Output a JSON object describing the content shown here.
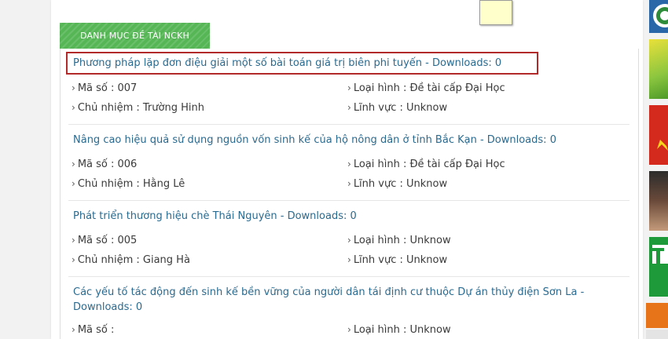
{
  "tab_label": "DANH MỤC ĐỀ TÀI NCKH",
  "label_prefixes": {
    "ma_so": "Mã số : ",
    "chu_nhiem": "Chủ nhiệm : ",
    "loai_hinh": "Loại hình : ",
    "linh_vuc": "Lĩnh vực : "
  },
  "items": [
    {
      "title": "Phương pháp lặp đơn điệu giải một số bài toán giá trị biên phi tuyến - Downloads: 0",
      "ma_so": "Mã số : 007",
      "loai_hinh": "Loại hình : Đề tài cấp Đại Học",
      "chu_nhiem": "Chủ nhiệm : Trường Hinh",
      "linh_vuc": "Lĩnh vực : Unknow"
    },
    {
      "title": "Nâng cao hiệu quả sử dụng nguồn vốn sinh kế của hộ nông dân ở tỉnh Bắc Kạn - Downloads: 0",
      "ma_so": "Mã số : 006",
      "loai_hinh": "Loại hình : Đề tài cấp Đại Học",
      "chu_nhiem": "Chủ nhiệm : Hằng Lê",
      "linh_vuc": "Lĩnh vực : Unknow"
    },
    {
      "title": "Phát triển thương hiệu chè Thái Nguyên - Downloads: 0",
      "ma_so": "Mã số : 005",
      "loai_hinh": "Loại hình : Unknow",
      "chu_nhiem": "Chủ nhiệm : Giang Hà",
      "linh_vuc": "Lĩnh vực : Unknow"
    },
    {
      "title_line1": "Các yếu tố tác động đến sinh kế bền vững của người dân tái định cư thuộc Dự án thủy điện Sơn La -",
      "title_line2": "Downloads: 0",
      "ma_so": "Mã số :",
      "loai_hinh": "Loại hình : Unknow"
    }
  ],
  "colors": {
    "tab_green": "#56b656",
    "link_blue": "#2b6a8f",
    "highlight_red": "#b22a2a"
  }
}
